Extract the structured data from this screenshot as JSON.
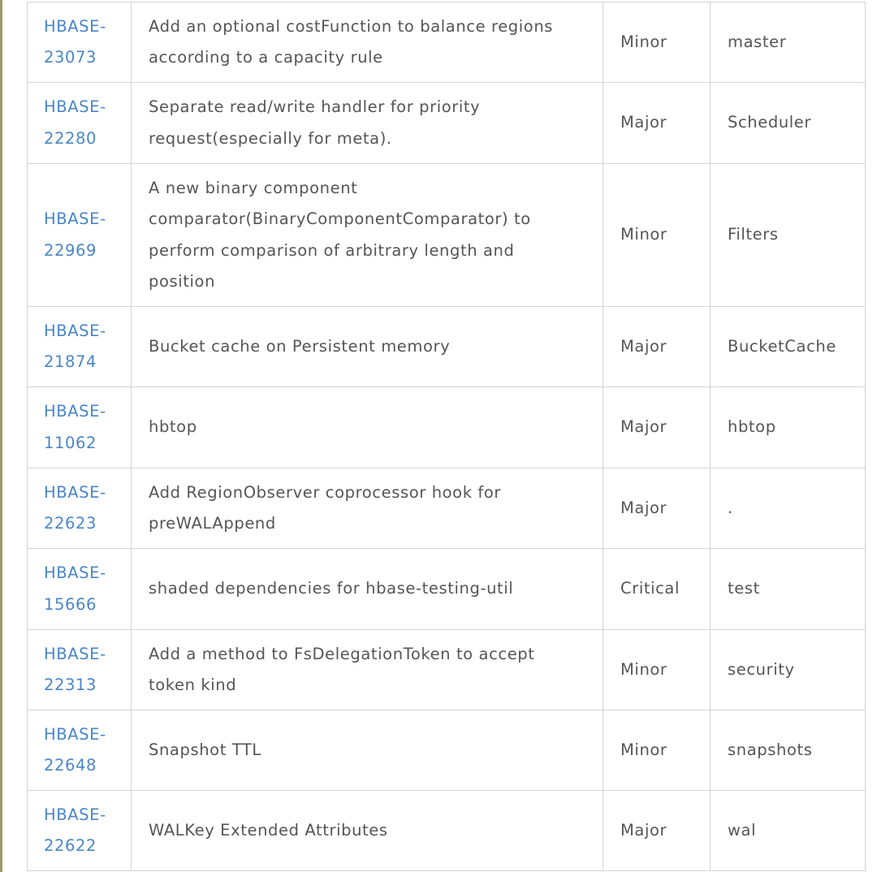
{
  "rows": [
    {
      "id": "HBASE-23073",
      "id_a": "HBASE-",
      "id_b": "23073",
      "summary": "Add an optional costFunction to balance regions according to a capacity rule",
      "priority": "Minor",
      "component": "master"
    },
    {
      "id": "HBASE-22280",
      "id_a": "HBASE-",
      "id_b": "22280",
      "summary": "Separate read/write handler for priority request(especially for meta).",
      "priority": "Major",
      "component": "Scheduler"
    },
    {
      "id": "HBASE-22969",
      "id_a": "HBASE-",
      "id_b": "22969",
      "summary": "A new binary component comparator(BinaryComponentComparator) to perform comparison of arbitrary length and position",
      "priority": "Minor",
      "component": "Filters"
    },
    {
      "id": "HBASE-21874",
      "id_a": "HBASE-",
      "id_b": "21874",
      "summary": "Bucket cache on Persistent memory",
      "priority": "Major",
      "component": "BucketCache"
    },
    {
      "id": "HBASE-11062",
      "id_a": "HBASE-",
      "id_b": "11062",
      "summary": "hbtop",
      "priority": "Major",
      "component": "hbtop"
    },
    {
      "id": "HBASE-22623",
      "id_a": "HBASE-",
      "id_b": "22623",
      "summary": "Add RegionObserver coprocessor hook for preWALAppend",
      "priority": "Major",
      "component": "."
    },
    {
      "id": "HBASE-15666",
      "id_a": "HBASE-",
      "id_b": "15666",
      "summary": "shaded dependencies for hbase-testing-util",
      "priority": "Critical",
      "component": "test"
    },
    {
      "id": "HBASE-22313",
      "id_a": "HBASE-",
      "id_b": "22313",
      "summary": "Add a method to FsDelegationToken to accept token kind",
      "priority": "Minor",
      "component": "security"
    },
    {
      "id": "HBASE-22648",
      "id_a": "HBASE-",
      "id_b": "22648",
      "summary": "Snapshot TTL",
      "priority": "Minor",
      "component": "snapshots"
    },
    {
      "id": "HBASE-22622",
      "id_a": "HBASE-",
      "id_b": "22622",
      "summary": "WALKey Extended Attributes",
      "priority": "Major",
      "component": "wal"
    }
  ]
}
